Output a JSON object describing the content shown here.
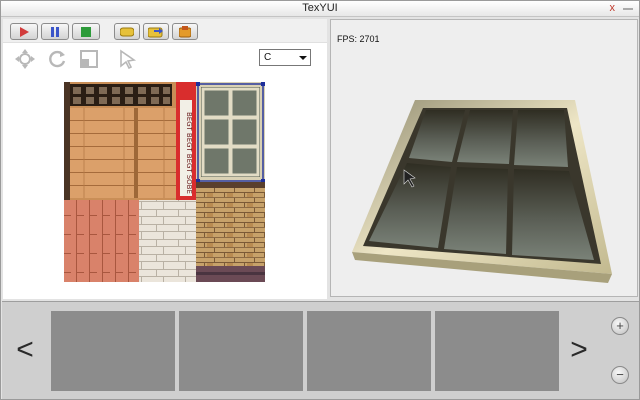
{
  "window": {
    "title": "TexYUI",
    "close_glyph": "x"
  },
  "toolbar": {
    "buttons": [
      {
        "name": "play-button",
        "icon": "play-icon",
        "color": "#d23c3c"
      },
      {
        "name": "pause-button",
        "icon": "pause-icon",
        "color": "#3b55c9"
      },
      {
        "name": "stop-button",
        "icon": "stop-icon",
        "color": "#2d9b3a"
      },
      {
        "name": "load-button",
        "icon": "load-icon",
        "color": "#e6c13a"
      },
      {
        "name": "open-button",
        "icon": "folder-open-icon",
        "color": "#e6c13a"
      },
      {
        "name": "save-button",
        "icon": "save-icon",
        "color": "#e39a2a"
      }
    ]
  },
  "tools": {
    "icons": [
      "move-icon",
      "rotate-icon",
      "scale-icon",
      "select-cursor-icon"
    ],
    "select": {
      "value": "C"
    }
  },
  "atlas": {
    "selected_tile": "window-frame",
    "selection_color": "#1f2f9a",
    "strip_text": "BEGT BEGT BEGT SOBE"
  },
  "viewport": {
    "fps_label": "FPS: 2701"
  },
  "bottom": {
    "prev_glyph": "<",
    "next_glyph": ">",
    "zoom_in_glyph": "+",
    "zoom_out_glyph": "−",
    "thumb_count": 4
  }
}
